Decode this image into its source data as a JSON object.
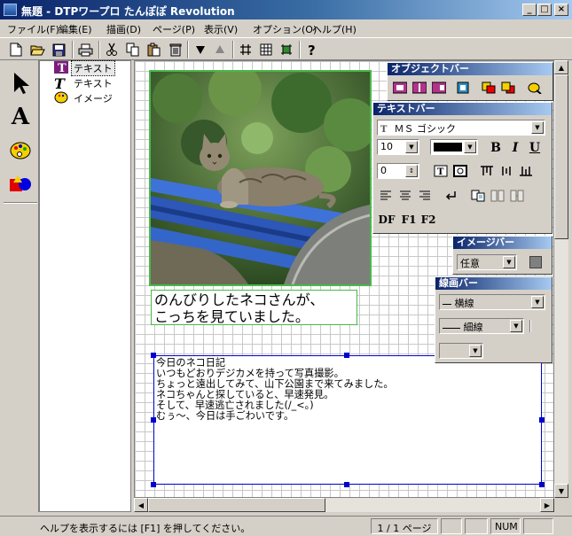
{
  "window": {
    "title": "無題 - DTPワープロ たんぽぽ Revolution",
    "controls": {
      "minimize": "_",
      "maximize": "□",
      "close": "×"
    }
  },
  "menu": [
    "ファイル(F)",
    "編集(E)",
    "描画(D)",
    "ページ(P)",
    "表示(V)",
    "オプション(O)",
    "ヘルプ(H)"
  ],
  "toolbar": {
    "icons": [
      "new-icon",
      "open-icon",
      "save-icon",
      "print-icon",
      "cut-icon",
      "copy-icon",
      "paste-icon",
      "delete-icon",
      "bring-front-icon",
      "send-back-icon",
      "grid-icon",
      "table-icon",
      "frame-icon",
      "help-icon"
    ]
  },
  "palette": {
    "tools": [
      "select-arrow-icon",
      "text-tool-icon",
      "image-tool-icon",
      "shape-tool-icon"
    ],
    "text_tool_glyph": "A"
  },
  "tree": {
    "items": [
      {
        "label": "テキスト",
        "icon": "text-frame-icon",
        "selected": true
      },
      {
        "label": "テキスト",
        "icon": "text-tool-icon",
        "selected": false
      },
      {
        "label": "イメージ",
        "icon": "image-icon",
        "selected": false
      }
    ],
    "text_glyph": "T"
  },
  "document": {
    "caption_lines": [
      "のんびりしたネコさんが、",
      "こっちを見ていました。"
    ],
    "diary_lines": [
      "今日のネコ日記",
      "いつもどおりデジカメを持って写真撮影。",
      "ちょっと遠出してみて、山下公園まで来てみました。",
      "ネコちゃんと探していると、早速発見。",
      "そして、早速逃亡されました(/_<。)",
      "むぅ～、今日は手ごわいです。"
    ]
  },
  "panels": {
    "object": {
      "title": "オブジェクトバー"
    },
    "text": {
      "title": "テキストバー",
      "font": "ＭＳ ゴシック",
      "font_glyph": "T",
      "size": "10",
      "spacing": "0",
      "bold": "B",
      "italic": "I",
      "underline": "U",
      "fields": [
        "DF",
        "F1",
        "F2"
      ],
      "text_color": "#000000"
    },
    "image": {
      "title": "イメージバー",
      "mode": "任意"
    },
    "line": {
      "title": "線画バー",
      "line_type": "横線",
      "line_width": "細線"
    }
  },
  "status": {
    "help": "ヘルプを表示するには [F1] を押してください。",
    "page": "1 / 1 ページ",
    "num": "NUM"
  }
}
